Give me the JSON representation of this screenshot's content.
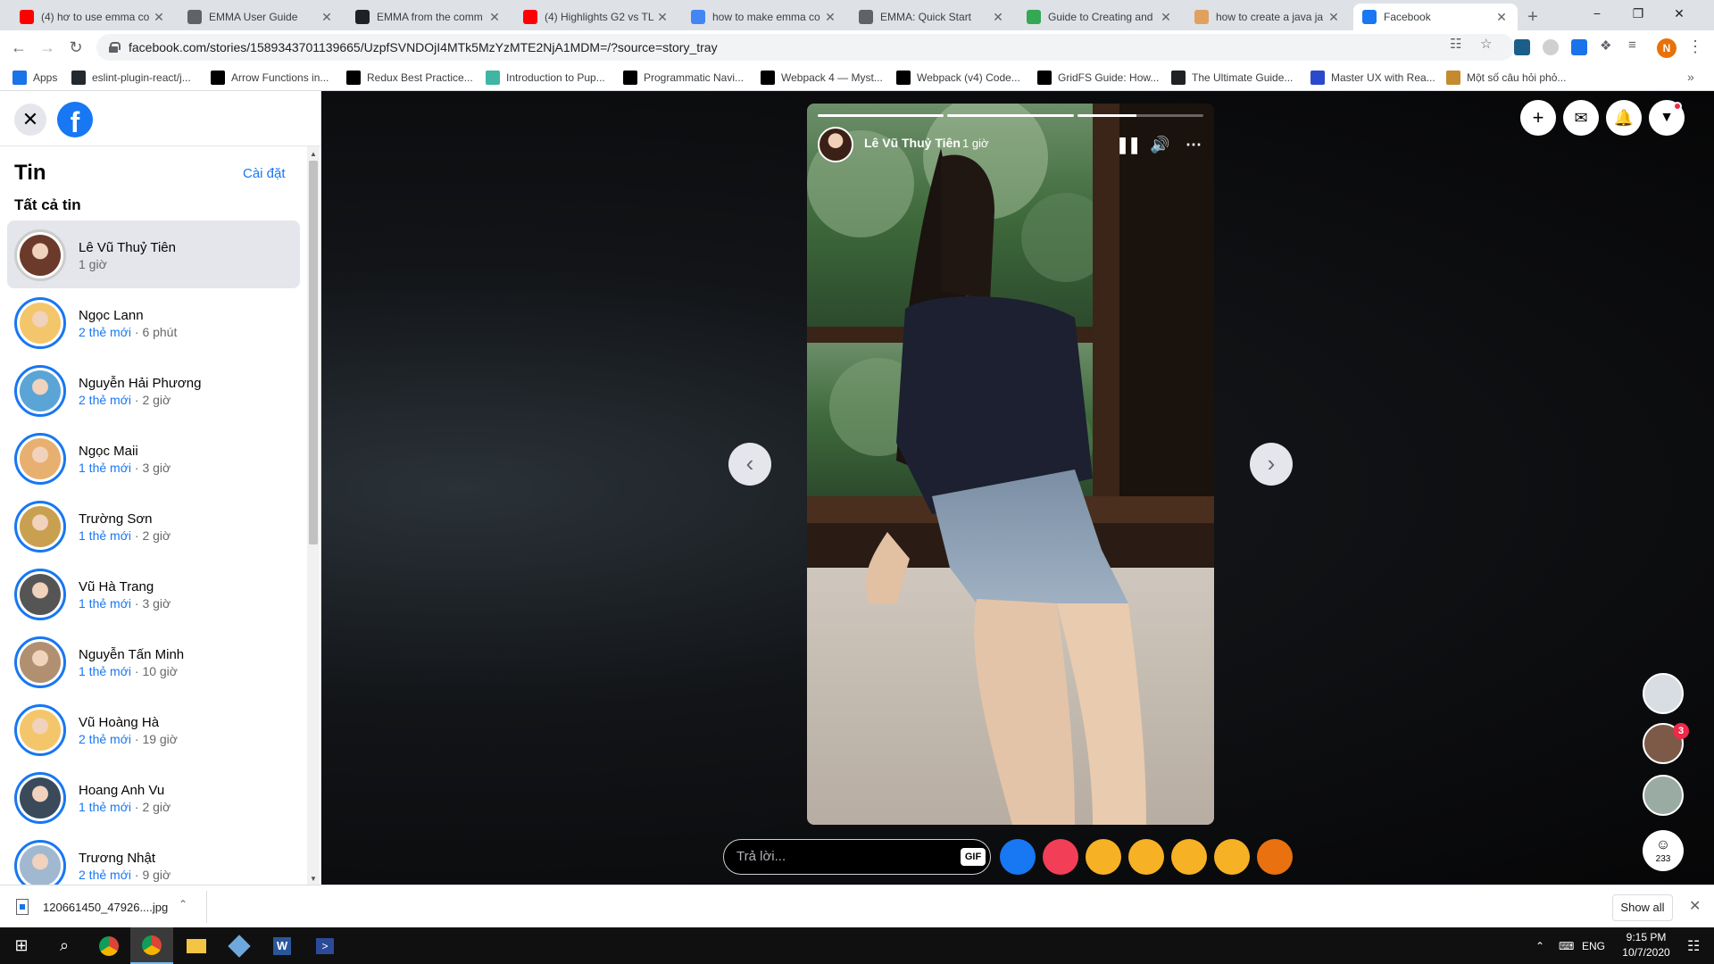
{
  "browser": {
    "tabs": [
      {
        "title": "(4) hơ to use emma co",
        "icon": "youtube-icon",
        "color": "#ff0000"
      },
      {
        "title": "EMMA User Guide",
        "icon": "emma-icon",
        "color": "#5f6368"
      },
      {
        "title": "EMMA from the comm",
        "icon": "globe-icon",
        "color": "#202124"
      },
      {
        "title": "(4) Highlights G2 vs TL",
        "icon": "youtube-icon",
        "color": "#ff0000"
      },
      {
        "title": "how to make emma co",
        "icon": "google-icon",
        "color": "#4285f4"
      },
      {
        "title": "EMMA: Quick Start",
        "icon": "emma-icon",
        "color": "#5f6368"
      },
      {
        "title": "Guide to Creating and",
        "icon": "doc-icon",
        "color": "#34a853"
      },
      {
        "title": "how to create a java ja",
        "icon": "java-icon",
        "color": "#e0a060"
      },
      {
        "title": "Facebook",
        "icon": "facebook-icon",
        "color": "#1877f2"
      }
    ],
    "url": "facebook.com/stories/1589343701139665/UzpfSVNDOjI4MTk5MzYzMTE2NjA1MDM=/?source=story_tray",
    "bookmarks": [
      {
        "label": "Apps",
        "icon": "apps-grid-icon",
        "color": "#1a73e8"
      },
      {
        "label": "eslint-plugin-react/j...",
        "icon": "github-icon",
        "color": "#24292e"
      },
      {
        "label": "Arrow Functions in...",
        "icon": "medium-icon",
        "color": "#000000"
      },
      {
        "label": "Redux Best Practice...",
        "icon": "medium-icon",
        "color": "#000000"
      },
      {
        "label": "Introduction to Pup...",
        "icon": "puppeteer-icon",
        "color": "#40b5a4"
      },
      {
        "label": "Programmatic Navi...",
        "icon": "dev-icon",
        "color": "#000000"
      },
      {
        "label": "Webpack 4 — Myst...",
        "icon": "medium-icon",
        "color": "#000000"
      },
      {
        "label": "Webpack (v4) Code...",
        "icon": "medium-icon",
        "color": "#000000"
      },
      {
        "label": "GridFS Guide: How...",
        "icon": "gridfs-icon",
        "color": "#000000"
      },
      {
        "label": "The Ultimate Guide...",
        "icon": "guide-icon",
        "color": "#202124"
      },
      {
        "label": "Master UX with Rea...",
        "icon": "co-icon",
        "color": "#2b4acb"
      },
      {
        "label": "Một số câu hỏi phỏ...",
        "icon": "box-icon",
        "color": "#c58a2f"
      }
    ],
    "profile_initial": "N"
  },
  "sidebar": {
    "title": "Tin",
    "settings_label": "Cài đặt",
    "section_label": "Tất cả tin",
    "stories": [
      {
        "name": "Lê Vũ Thuỷ Tiên",
        "new": "",
        "time": "1 giờ",
        "selected": true,
        "avatar_color": "#6b3a2a"
      },
      {
        "name": "Ngọc Lann",
        "new": "2 thẻ mới",
        "time": "6 phút",
        "selected": false,
        "avatar_color": "#f4c66c"
      },
      {
        "name": "Nguyễn Hải Phương",
        "new": "2 thẻ mới",
        "time": "2 giờ",
        "selected": false,
        "avatar_color": "#5ba4d6"
      },
      {
        "name": "Ngọc Maii",
        "new": "1 thẻ mới",
        "time": "3 giờ",
        "selected": false,
        "avatar_color": "#e8b070"
      },
      {
        "name": "Trường Sơn",
        "new": "1 thẻ mới",
        "time": "2 giờ",
        "selected": false,
        "avatar_color": "#c9a050"
      },
      {
        "name": "Vũ Hà Trang",
        "new": "1 thẻ mới",
        "time": "3 giờ",
        "selected": false,
        "avatar_color": "#555555"
      },
      {
        "name": "Nguyễn Tấn Minh",
        "new": "1 thẻ mới",
        "time": "10 giờ",
        "selected": false,
        "avatar_color": "#b09070"
      },
      {
        "name": "Vũ Hoàng Hà",
        "new": "2 thẻ mới",
        "time": "19 giờ",
        "selected": false,
        "avatar_color": "#f4c66c"
      },
      {
        "name": "Hoang Anh Vu",
        "new": "1 thẻ mới",
        "time": "2 giờ",
        "selected": false,
        "avatar_color": "#3a4a5a"
      },
      {
        "name": "Trương Nhật",
        "new": "2 thẻ mới",
        "time": "9 giờ",
        "selected": false,
        "avatar_color": "#a0b8d0"
      }
    ]
  },
  "story": {
    "author": "Lê Vũ Thuỷ Tiên",
    "time": "1 giờ",
    "progress": [
      1.0,
      1.0,
      0.47
    ],
    "reply_placeholder": "Trả lời...",
    "gif_label": "GIF",
    "reactions": [
      "like",
      "love",
      "care",
      "haha",
      "wow",
      "sad",
      "angry"
    ]
  },
  "contacts": {
    "badge_count": "3",
    "group_count": "233"
  },
  "downloads": {
    "filename": "120661450_47926....jpg",
    "show_all": "Show all"
  },
  "taskbar": {
    "lang": "ENG",
    "time": "9:15 PM",
    "date": "10/7/2020"
  }
}
